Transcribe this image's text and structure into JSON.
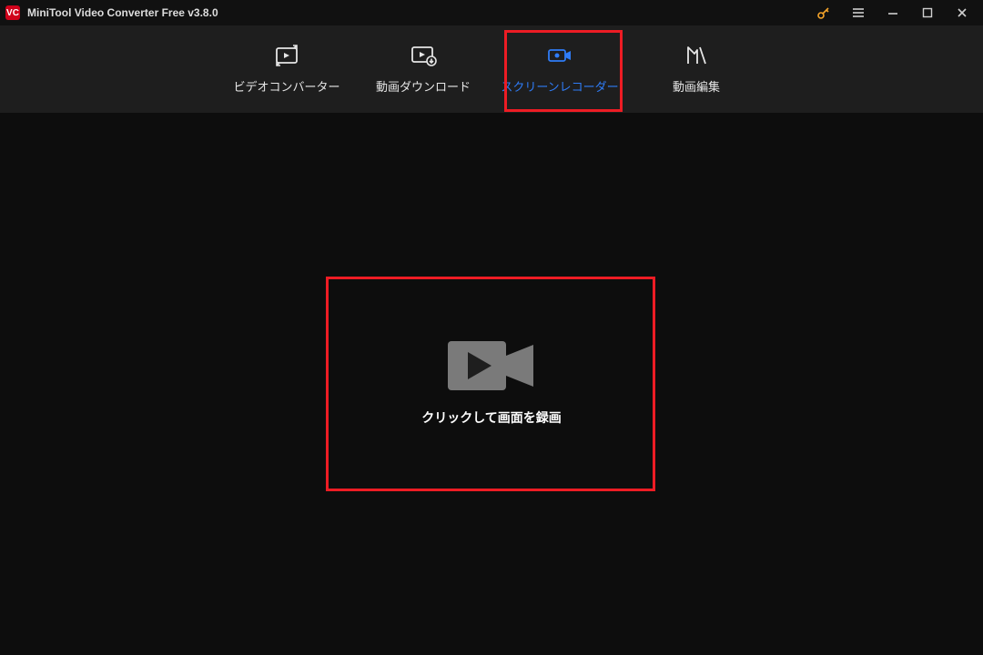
{
  "titlebar": {
    "title": "MiniTool Video Converter Free v3.8.0"
  },
  "tabs": [
    {
      "label": "ビデオコンバーター"
    },
    {
      "label": "動画ダウンロード"
    },
    {
      "label": "スクリーンレコーダー"
    },
    {
      "label": "動画編集"
    }
  ],
  "main": {
    "record_cta": "クリックして画面を録画"
  },
  "colors": {
    "accent": "#2f7cf6",
    "highlight": "#ed1c24",
    "logo": "#d0021b"
  }
}
